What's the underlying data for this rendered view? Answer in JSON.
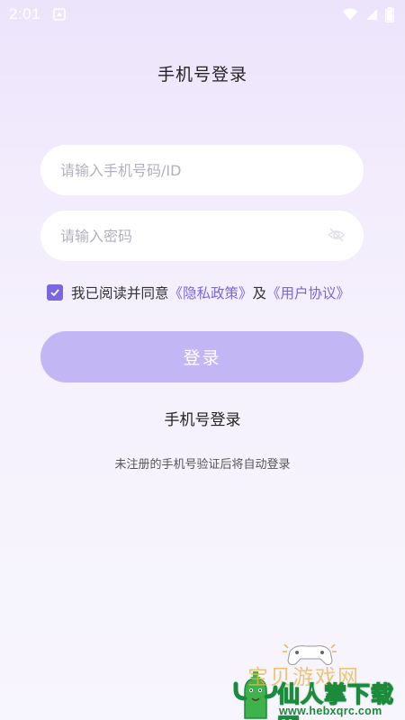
{
  "status_bar": {
    "time": "2:01"
  },
  "page": {
    "title": "手机号登录"
  },
  "form": {
    "phone_placeholder": "请输入手机号码/ID",
    "password_placeholder": "请输入密码",
    "agree_prefix": "我已阅读并同意",
    "privacy_link": "《隐私政策》",
    "conjunction": "及",
    "agreement_link": "《用户协议》",
    "agree_checked": true,
    "login_label": "登录"
  },
  "alt_login_label": "手机号登录",
  "hint": "未注册的手机号验证后将自动登录",
  "watermark": {
    "site_cn": "宝贝游戏网",
    "brand": "仙人掌下载网",
    "url": "www.hebxqrc.com"
  },
  "colors": {
    "accent": "#7a66e0",
    "button": "#c2b6f4",
    "background": "#f2ecfc"
  }
}
